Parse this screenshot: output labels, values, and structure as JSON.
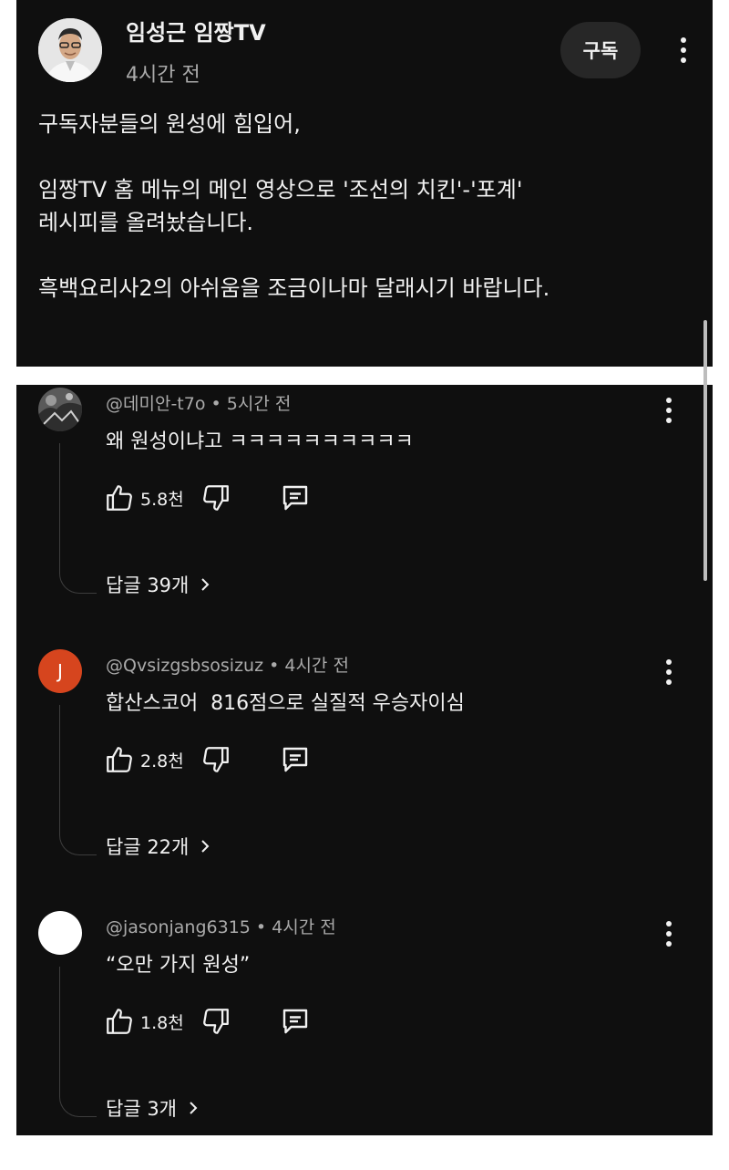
{
  "post": {
    "channel_name": "임성근 임짱TV",
    "time": "4시간 전",
    "subscribe_label": "구독",
    "body_lines": [
      "구독자분들의 원성에 힘입어,",
      "",
      "임짱TV 홈 메뉴의 메인 영상으로 '조선의 치킨'-'포계'",
      "레시피를 올려놨습니다.",
      "",
      "흑백요리사2의 아쉬움을 조금이나마 달래시기 바랍니다."
    ]
  },
  "comments": [
    {
      "author": "@데미안-t7o",
      "time": "5시간 전",
      "text": "왜 원성이냐고 ㅋㅋㅋㅋㅋㅋㅋㅋㅋㅋ",
      "likes": "5.8천",
      "replies": "답글 39개",
      "avatar": {
        "type": "photo",
        "bg": "#6b6b6b"
      }
    },
    {
      "author": "@Qvsizgsbsosizuz",
      "time": "4시간 전",
      "text": "합산스코어  816점으로 실질적 우승자이심",
      "likes": "2.8천",
      "replies": "답글 22개",
      "avatar": {
        "type": "letter",
        "letter": "J",
        "bg": "#d6451e"
      }
    },
    {
      "author": "@jasonjang6315",
      "time": "4시간 전",
      "text": "“오만 가지 원성”",
      "likes": "1.8천",
      "replies": "답글 3개",
      "avatar": {
        "type": "blank",
        "bg": "#ffffff"
      }
    }
  ],
  "icons": {
    "like": "thumb-up-icon",
    "dislike": "thumb-down-icon",
    "reply": "comment-icon",
    "more": "more-vert-icon",
    "chevron": "chevron-right-icon"
  },
  "colors": {
    "background": "#0f0f0f",
    "secondary_text": "#aaaaaa",
    "subscribe_bg": "#272727"
  }
}
